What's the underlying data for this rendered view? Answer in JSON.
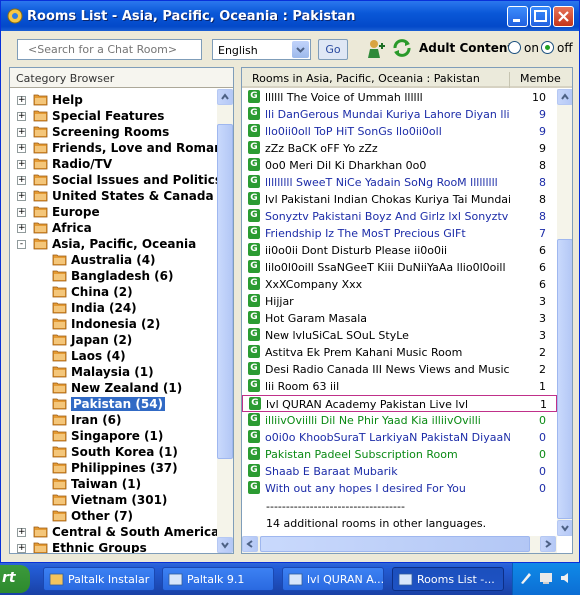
{
  "window": {
    "title": "Rooms List - Asia, Pacific, Oceania : Pakistan"
  },
  "toolbar": {
    "search_placeholder": "<Search for a Chat Room>",
    "language": "English",
    "go_label": "Go",
    "adult_label": "Adult Content:",
    "on_label": "on",
    "off_label": "off",
    "adult_selected": "off"
  },
  "category_browser": {
    "header": "Category Browser",
    "items": [
      {
        "label": "Help",
        "level": 0,
        "expander": "+"
      },
      {
        "label": "Special Features",
        "level": 0,
        "expander": "+"
      },
      {
        "label": "Screening Rooms",
        "level": 0,
        "expander": "+"
      },
      {
        "label": "Friends, Love and Romance",
        "level": 0,
        "expander": "+"
      },
      {
        "label": "Radio/TV",
        "level": 0,
        "expander": "+"
      },
      {
        "label": "Social Issues and Politics",
        "level": 0,
        "expander": "+"
      },
      {
        "label": "United States & Canada",
        "level": 0,
        "expander": "+"
      },
      {
        "label": "Europe",
        "level": 0,
        "expander": "+"
      },
      {
        "label": "Africa",
        "level": 0,
        "expander": "+"
      },
      {
        "label": "Asia, Pacific, Oceania",
        "level": 0,
        "expander": "-"
      },
      {
        "label": "Australia (4)",
        "level": 1
      },
      {
        "label": "Bangladesh (6)",
        "level": 1
      },
      {
        "label": "China (2)",
        "level": 1
      },
      {
        "label": "India (24)",
        "level": 1
      },
      {
        "label": "Indonesia (2)",
        "level": 1
      },
      {
        "label": "Japan (2)",
        "level": 1
      },
      {
        "label": "Laos (4)",
        "level": 1
      },
      {
        "label": "Malaysia (1)",
        "level": 1
      },
      {
        "label": "New Zealand (1)",
        "level": 1
      },
      {
        "label": "Pakistan (54)",
        "level": 1,
        "selected": true
      },
      {
        "label": "Iran (6)",
        "level": 1
      },
      {
        "label": "Singapore (1)",
        "level": 1
      },
      {
        "label": "South Korea (1)",
        "level": 1
      },
      {
        "label": "Philippines (37)",
        "level": 1
      },
      {
        "label": "Taiwan (1)",
        "level": 1
      },
      {
        "label": "Vietnam (301)",
        "level": 1
      },
      {
        "label": "Other (7)",
        "level": 1
      },
      {
        "label": "Central & South America",
        "level": 0,
        "expander": "+"
      },
      {
        "label": "Ethnic Groups",
        "level": 0,
        "expander": "+"
      }
    ]
  },
  "rooms": {
    "header_room": "Rooms in Asia, Pacific, Oceania : Pakistan",
    "header_members": "Membe",
    "list": [
      {
        "name": "llllll The Voice of Ummah llllll",
        "count": "10",
        "color": "black"
      },
      {
        "name": "lli DanGerous Mundai Kuriya Lahore Diyan lli",
        "count": "9",
        "color": "blue"
      },
      {
        "name": "llo0ii0oll ToP HiT SonGs llo0ii0oll",
        "count": "9",
        "color": "blue"
      },
      {
        "name": "zZz BaCK oFF Yo zZz",
        "count": "9",
        "color": "black"
      },
      {
        "name": "0o0 Meri Dil Ki Dharkhan 0o0",
        "count": "8",
        "color": "black"
      },
      {
        "name": "lllllllll SweeT NiCe Yadain SoNg RooM lllllllll",
        "count": "8",
        "color": "blue"
      },
      {
        "name": "lvl Pakistani Indian Chokas Kuriya Tai Mundai lvl",
        "count": "8",
        "color": "black"
      },
      {
        "name": "Sonyztv Pakistani Boyz And Girlz lxl Sonyztv",
        "count": "8",
        "color": "blue"
      },
      {
        "name": "Friendship Iz The MosT Precious GIFt",
        "count": "7",
        "color": "blue"
      },
      {
        "name": "ii0o0ii Dont Disturb Please ii0o0ii",
        "count": "6",
        "color": "black"
      },
      {
        "name": "lilo0l0oill SsaNGeeT Kiii DuNiiYaAa llio0l0oill",
        "count": "6",
        "color": "black"
      },
      {
        "name": "XxXCompany Xxx",
        "count": "6",
        "color": "black"
      },
      {
        "name": "Hijjar",
        "count": "3",
        "color": "black"
      },
      {
        "name": "Hot Garam Masala",
        "count": "3",
        "color": "black"
      },
      {
        "name": "New lvluSiCaL SOuL StyLe",
        "count": "3",
        "color": "black"
      },
      {
        "name": "Astitva Ek Prem Kahani Music Room",
        "count": "2",
        "color": "black"
      },
      {
        "name": "Desi Radio Canada III News Views and Music",
        "count": "2",
        "color": "black"
      },
      {
        "name": "lii Room 63 iil",
        "count": "1",
        "color": "black"
      },
      {
        "name": "lvl QURAN Academy Pakistan Live lvl",
        "count": "1",
        "color": "black",
        "highlighted": true
      },
      {
        "name": "illiivOviilli Dil Ne Phir Yaad Kia illiivOvilli",
        "count": "0",
        "color": "green"
      },
      {
        "name": "o0i0o KhoobSuraT LarkiyaN PakistaN DiyaaN o0i0o",
        "count": "0",
        "color": "blue"
      },
      {
        "name": "Pakistan Padeel Subscription Room",
        "count": "0",
        "color": "green"
      },
      {
        "name": "Shaab E Baraat Mubarik",
        "count": "0",
        "color": "blue"
      },
      {
        "name": "With out any hopes I desired For You",
        "count": "0",
        "color": "blue"
      }
    ],
    "separator": "-----------------------------------",
    "more_text": "14 additional rooms in other languages."
  },
  "taskbar": {
    "start_label": "rt",
    "tasks": [
      {
        "label": "Paltalk Instalar"
      },
      {
        "label": "Paltalk 9.1"
      },
      {
        "label": "lvl QURAN A..."
      },
      {
        "label": "Rooms List -...",
        "active": true
      }
    ]
  },
  "colors": {
    "blue_room": "#1c2ca8",
    "green_room": "#0a8a14",
    "title_bar": "#0a58d8",
    "highlight": "#c0308a"
  }
}
